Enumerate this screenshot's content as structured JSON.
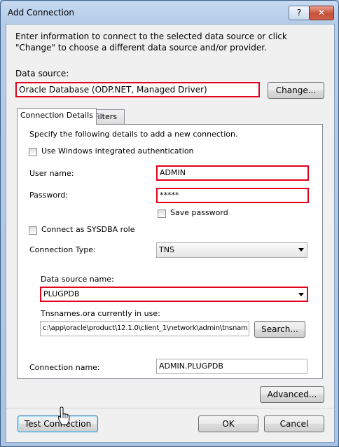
{
  "window": {
    "title": "Add Connection",
    "help_glyph": "?",
    "close_glyph": "✕"
  },
  "intro": "Enter information to connect to the selected data source or click \"Change\" to choose a different data source and/or provider.",
  "data_source": {
    "label": "Data source:",
    "value": "Oracle Database (ODP.NET, Managed Driver)",
    "change_label": "Change..."
  },
  "tabs": [
    {
      "label": "Connection Details"
    },
    {
      "label": "Filters"
    }
  ],
  "details": {
    "instruction": "Specify the following details to add a new connection.",
    "windows_auth": {
      "label": "Use Windows integrated authentication",
      "checked": false
    },
    "user_name": {
      "label": "User name:",
      "value": "ADMIN"
    },
    "password": {
      "label": "Password:",
      "value": "*****"
    },
    "save_password": {
      "label": "Save password",
      "checked": false
    },
    "sysdba": {
      "label": "Connect as SYSDBA role",
      "checked": false
    },
    "connection_type": {
      "label": "Connection Type:",
      "value": "TNS"
    },
    "data_source_name": {
      "label": "Data source name:",
      "value": "PLUGPDB"
    },
    "tnsnames": {
      "label": "Tnsnames.ora currently in use:",
      "value": "c:\\app\\oracle\\product\\12.1.0\\client_1\\network\\admin\\tnsnam",
      "search_label": "Search..."
    },
    "connection_name": {
      "label": "Connection name:",
      "value": "ADMIN.PLUGPDB"
    }
  },
  "buttons": {
    "advanced": "Advanced...",
    "test": "Test Connection",
    "ok": "OK",
    "cancel": "Cancel"
  },
  "colors": {
    "highlight": "#e2001a",
    "chrome": "#a9c4e4"
  }
}
